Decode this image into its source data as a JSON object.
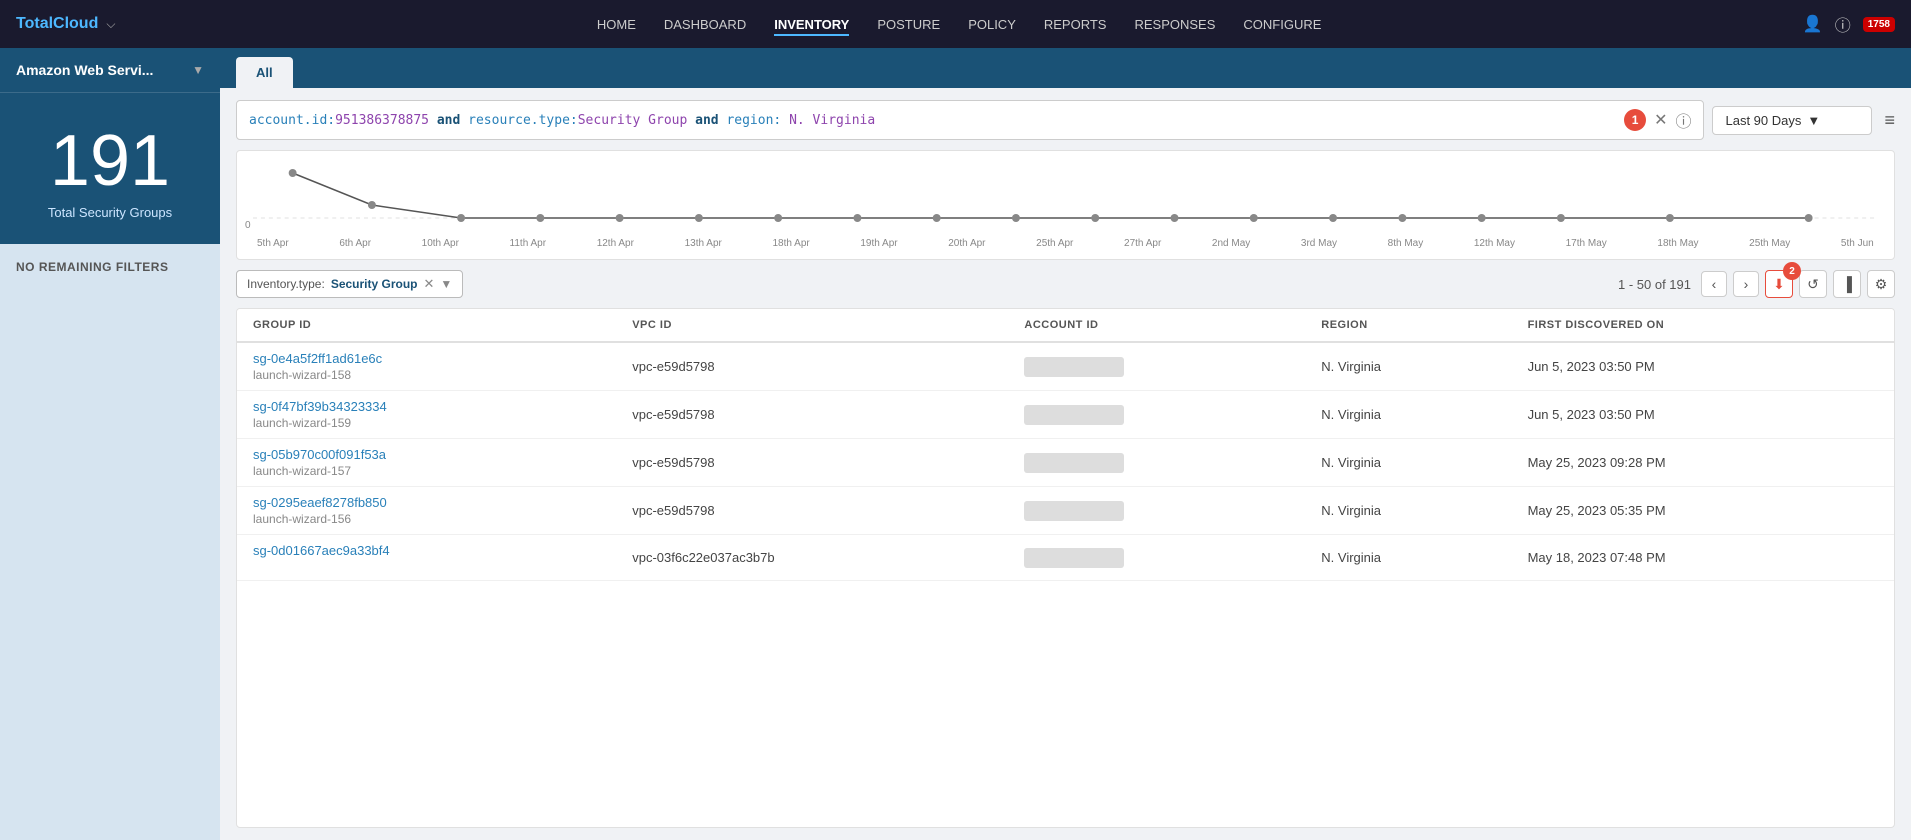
{
  "app": {
    "brand": "TotalCloud",
    "notification_count": "1758"
  },
  "nav": {
    "items": [
      {
        "label": "HOME",
        "active": false
      },
      {
        "label": "DASHBOARD",
        "active": false
      },
      {
        "label": "INVENTORY",
        "active": true
      },
      {
        "label": "POSTURE",
        "active": false
      },
      {
        "label": "POLICY",
        "active": false
      },
      {
        "label": "REPORTS",
        "active": false
      },
      {
        "label": "RESPONSES",
        "active": false
      },
      {
        "label": "CONFIGURE",
        "active": false
      }
    ]
  },
  "sidebar": {
    "account_name": "Amazon Web Servi...",
    "count": "191",
    "count_label": "Total Security Groups",
    "no_filters": "NO REMAINING FILTERS"
  },
  "tabs": [
    {
      "label": "All",
      "active": true
    }
  ],
  "search": {
    "query_parts": [
      {
        "text": "account.id:",
        "type": "key"
      },
      {
        "text": "951386378875",
        "type": "value"
      },
      {
        "text": " and ",
        "type": "and"
      },
      {
        "text": "resource.type:",
        "type": "key"
      },
      {
        "text": "Security Group",
        "type": "value"
      },
      {
        "text": " and ",
        "type": "and"
      },
      {
        "text": "region:",
        "type": "key"
      },
      {
        "text": " N. Virginia",
        "type": "value"
      }
    ],
    "badge_label": "1",
    "date_range": "Last 90 Days"
  },
  "chart": {
    "y_label": "0",
    "x_labels": [
      "5th Apr",
      "6th Apr",
      "10th Apr",
      "11th Apr",
      "12th Apr",
      "13th Apr",
      "18th Apr",
      "19th Apr",
      "20th Apr",
      "25th Apr",
      "27th Apr",
      "2nd May",
      "3rd May",
      "8th May",
      "12th May",
      "17th May",
      "18th May",
      "25th May",
      "5th Jun"
    ]
  },
  "filter": {
    "tag_key": "Inventory.type:",
    "tag_value": "Security Group",
    "pagination": "1 - 50 of 191",
    "badge2_label": "2"
  },
  "table": {
    "columns": [
      "GROUP ID",
      "VPC ID",
      "ACCOUNT ID",
      "REGION",
      "FIRST DISCOVERED ON"
    ],
    "rows": [
      {
        "group_id": "sg-0e4a5f2ff1ad61e6c",
        "group_sub": "launch-wizard-158",
        "vpc_id": "vpc-e59d5798",
        "region": "N. Virginia",
        "discovered": "Jun 5, 2023 03:50 PM"
      },
      {
        "group_id": "sg-0f47bf39b34323334",
        "group_sub": "launch-wizard-159",
        "vpc_id": "vpc-e59d5798",
        "region": "N. Virginia",
        "discovered": "Jun 5, 2023 03:50 PM"
      },
      {
        "group_id": "sg-05b970c00f091f53a",
        "group_sub": "launch-wizard-157",
        "vpc_id": "vpc-e59d5798",
        "region": "N. Virginia",
        "discovered": "May 25, 2023 09:28 PM"
      },
      {
        "group_id": "sg-0295eaef8278fb850",
        "group_sub": "launch-wizard-156",
        "vpc_id": "vpc-e59d5798",
        "region": "N. Virginia",
        "discovered": "May 25, 2023 05:35 PM"
      },
      {
        "group_id": "sg-0d01667aec9a33bf4",
        "group_sub": "",
        "vpc_id": "vpc-03f6c22e037ac3b7b",
        "region": "N. Virginia",
        "discovered": "May 18, 2023 07:48 PM"
      }
    ]
  }
}
